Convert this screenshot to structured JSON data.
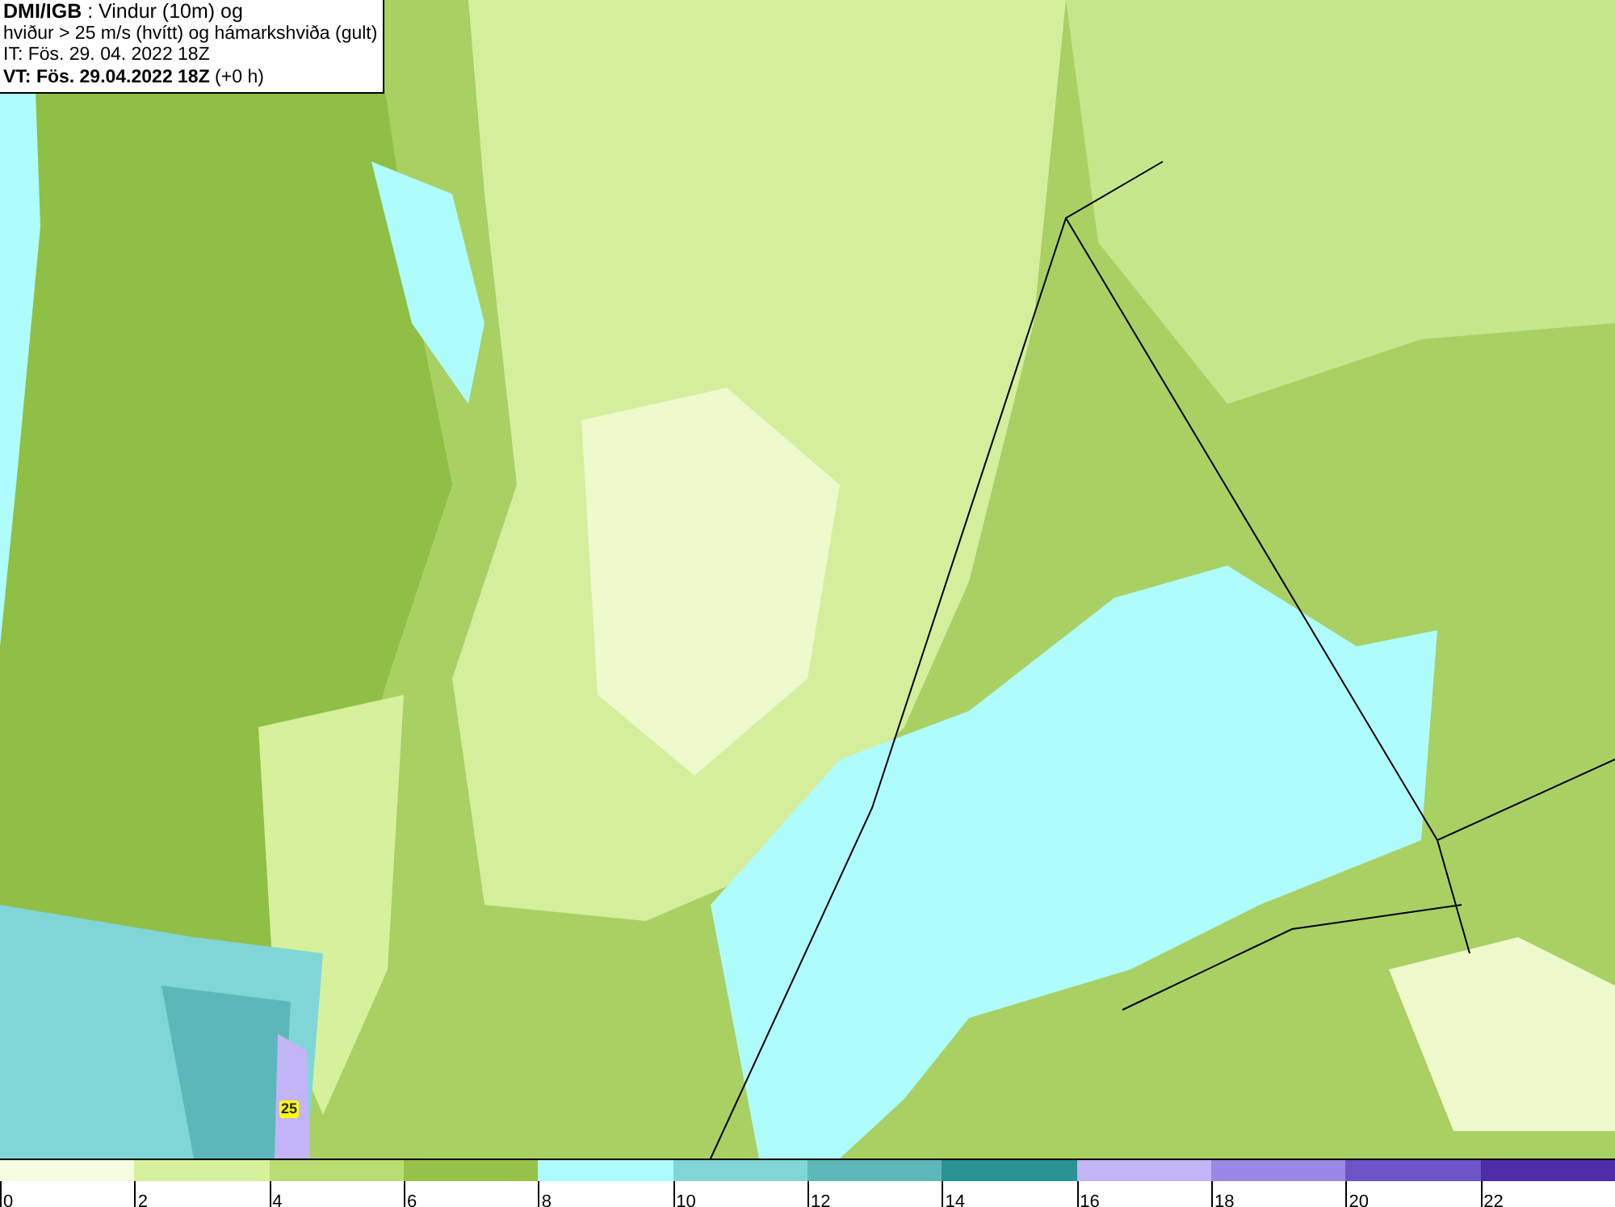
{
  "title_box": {
    "lines": [
      "**DMI/IGB** : Vindur (10m) og",
      "hviður > 25 m/s (hvítt) og hámarkshviða (gult)",
      "IT: Fös. 29. 04. 2022 18Z",
      "**VT: Fös. 29.04.2022 18Z** (+0 h)"
    ]
  },
  "map": {
    "gust_label": "25"
  },
  "legend": {
    "bins": [
      {
        "label": "0",
        "color": "#f5fde0"
      },
      {
        "label": "2",
        "color": "#d7f09b"
      },
      {
        "label": "4",
        "color": "#b9dd72"
      },
      {
        "label": "6",
        "color": "#97c24a"
      },
      {
        "label": "8",
        "color": "#aefcfc"
      },
      {
        "label": "10",
        "color": "#80d6d6"
      },
      {
        "label": "12",
        "color": "#5cb8b8"
      },
      {
        "label": "14",
        "color": "#2a9393"
      },
      {
        "label": "16",
        "color": "#c3b4f8"
      },
      {
        "label": "18",
        "color": "#9a88e4"
      },
      {
        "label": "20",
        "color": "#6d54c6"
      },
      {
        "label": "22",
        "color": "#4d2ea8"
      }
    ]
  }
}
